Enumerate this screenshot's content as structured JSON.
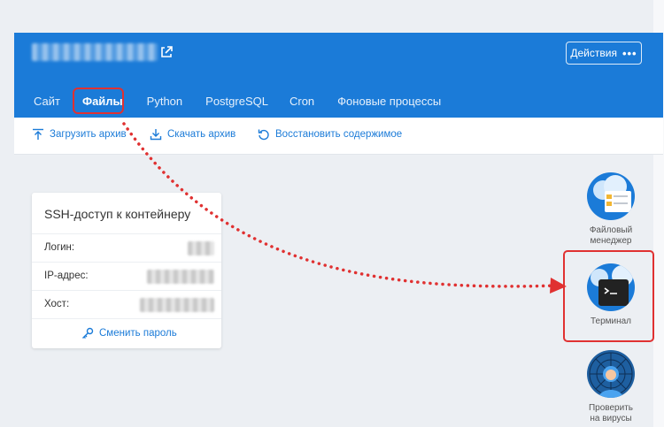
{
  "header": {
    "site_name": "",
    "actions_label": "Действия",
    "actions_dots": "•••"
  },
  "tabs": [
    {
      "label": "Сайт",
      "active": false
    },
    {
      "label": "Файлы",
      "active": true
    },
    {
      "label": "Python",
      "active": false
    },
    {
      "label": "PostgreSQL",
      "active": false
    },
    {
      "label": "Cron",
      "active": false
    },
    {
      "label": "Фоновые процессы",
      "active": false
    }
  ],
  "toolbar": {
    "upload_label": "Загрузить архив",
    "download_label": "Скачать архив",
    "restore_label": "Восстановить содержимое"
  },
  "ssh": {
    "title": "SSH-доступ к контейнеру",
    "rows": [
      {
        "label": "Логин:",
        "value": ""
      },
      {
        "label": "IP-адрес:",
        "value": ""
      },
      {
        "label": "Хост:",
        "value": ""
      }
    ],
    "change_password_label": "Сменить пароль"
  },
  "apps": [
    {
      "label_line1": "Файловый",
      "label_line2": "менеджер",
      "icon": "file-manager-icon"
    },
    {
      "label_line1": "Терминал",
      "label_line2": "",
      "icon": "terminal-icon"
    },
    {
      "label_line1": "Проверить",
      "label_line2": "на вирусы",
      "icon": "virus-check-icon"
    }
  ],
  "colors": {
    "brand_blue": "#1b7bd8",
    "highlight_red": "#e03131"
  }
}
